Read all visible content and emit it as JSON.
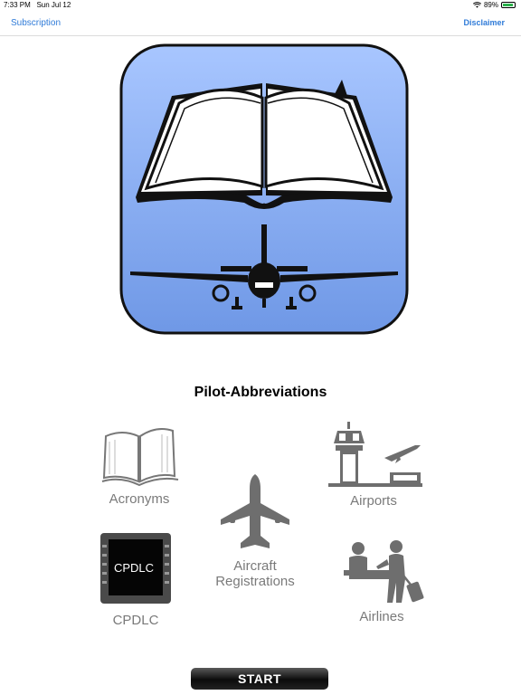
{
  "status_bar": {
    "time": "7:33 PM",
    "date": "Sun Jul 12",
    "battery": "89%",
    "battery_level": 0.89,
    "battery_color": "#2bb24c"
  },
  "nav": {
    "left_button": "Subscription",
    "right_button": "Disclaimer",
    "link_color": "#2f7bd8"
  },
  "app": {
    "title": "Pilot-Abbreviations",
    "icon_color": "#7fa6ec"
  },
  "menu": {
    "acronyms": "Acronyms",
    "airports": "Airports",
    "aircraft_line1": "Aircraft",
    "aircraft_line2": "Registrations",
    "cpdlc": "CPDLC",
    "cpdlc_screen_text": "CPDLC",
    "airlines": "Airlines"
  },
  "start_label": "START"
}
